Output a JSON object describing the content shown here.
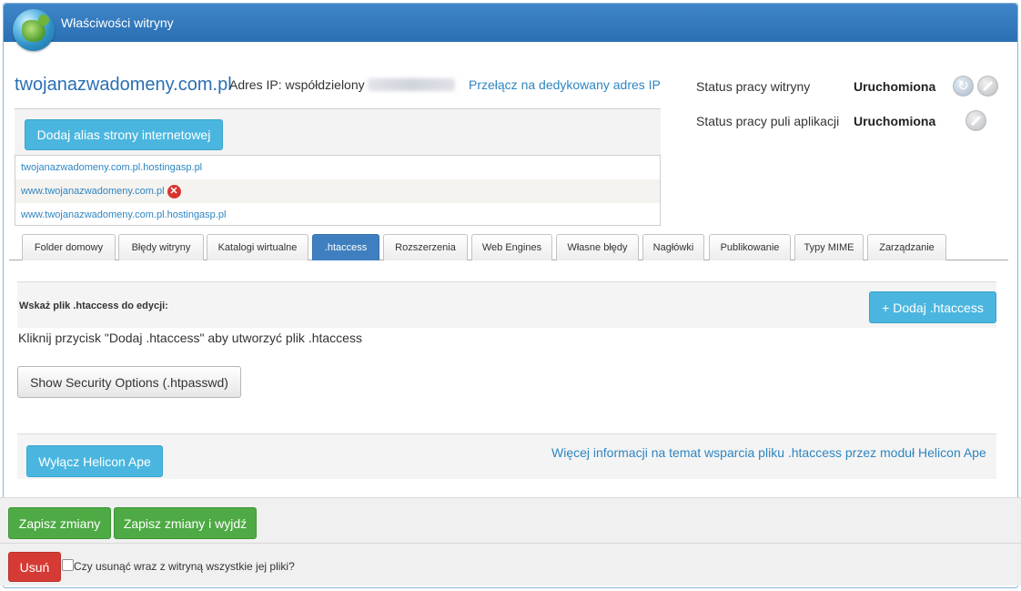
{
  "window": {
    "title": "Właściwości witryny"
  },
  "site": {
    "domain": "twojanazwadomeny.com.pl",
    "ip_label": "Adres IP: współdzielony",
    "switch_ip_link": "Przełącz na dedykowany adres IP"
  },
  "status": {
    "site_label": "Status pracy witryny",
    "site_value": "Uruchomiona",
    "pool_label": "Status pracy puli aplikacji",
    "pool_value": "Uruchomiona"
  },
  "aliases": {
    "add_button": "Dodaj alias strony internetowej",
    "items": [
      "twojanazwadomeny.com.pl.hostingasp.pl",
      "www.twojanazwadomeny.com.pl",
      "www.twojanazwadomeny.com.pl.hostingasp.pl"
    ]
  },
  "tabs": [
    {
      "label": "Folder domowy"
    },
    {
      "label": "Błędy witryny"
    },
    {
      "label": "Katalogi wirtualne"
    },
    {
      "label": ".htaccess"
    },
    {
      "label": "Rozszerzenia"
    },
    {
      "label": "Web Engines"
    },
    {
      "label": "Własne błędy"
    },
    {
      "label": "Nagłówki"
    },
    {
      "label": "Publikowanie"
    },
    {
      "label": "Typy MIME"
    },
    {
      "label": "Zarządzanie"
    }
  ],
  "active_tab": ".htaccess",
  "htaccess": {
    "select_label": "Wskaż plik .htaccess do edycji:",
    "add_button": "+ Dodaj .htaccess",
    "info": "Kliknij przycisk \"Dodaj .htaccess\" aby utworzyć plik .htaccess",
    "security_button": "Show Security Options (.htpasswd)",
    "helicon_button": "Wyłącz Helicon Ape",
    "helicon_link": "Więcej informacji na temat wsparcia pliku .htaccess przez moduł Helicon Ape"
  },
  "footer": {
    "save": "Zapisz zmiany",
    "save_exit": "Zapisz zmiany i wyjdź",
    "delete": "Usuń",
    "delete_files_label": "Czy usunąć wraz z witryną wszystkie jej pliki?"
  },
  "colors": {
    "header": "#2a6fb3",
    "info_button": "#4ab6df",
    "success_button": "#4eaa44",
    "danger_button": "#d53b34",
    "active_tab": "#3f7fbf",
    "link": "#2e86c1"
  },
  "icons": [
    "globe-icon",
    "refresh-icon",
    "stop-icon",
    "remove-alias-icon"
  ]
}
